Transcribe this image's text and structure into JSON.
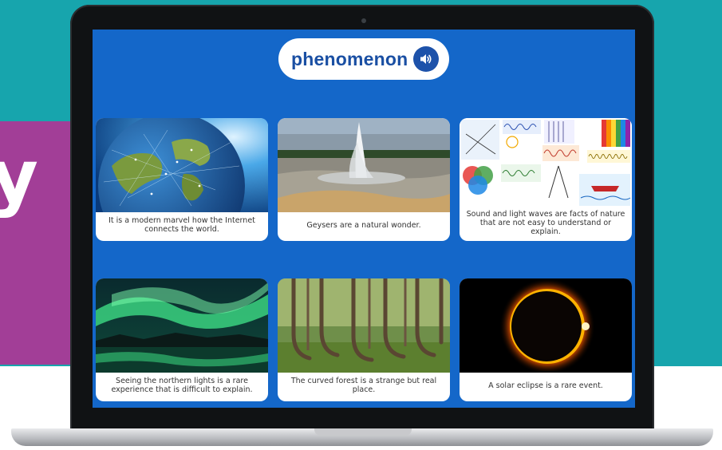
{
  "word": {
    "title": "phenomenon",
    "audio_icon": "speaker-icon"
  },
  "background": {
    "teal": "#17a5ad",
    "purple": "#a23e97",
    "letter": "y"
  },
  "screen_color": "#1467c9",
  "cards": [
    {
      "image": "earth-network-image",
      "caption": "It is a modern marvel how the Internet connects the world."
    },
    {
      "image": "geyser-image",
      "caption": "Geysers are a natural wonder."
    },
    {
      "image": "physics-diagrams-image",
      "caption": "Sound and light waves are facts of nature that are not easy to understand or explain."
    },
    {
      "image": "northern-lights-image",
      "caption": "Seeing the northern lights is a rare experience that is difficult to explain."
    },
    {
      "image": "curved-forest-image",
      "caption": "The curved forest is a strange but real place."
    },
    {
      "image": "solar-eclipse-image",
      "caption": "A solar eclipse is a rare event."
    }
  ]
}
